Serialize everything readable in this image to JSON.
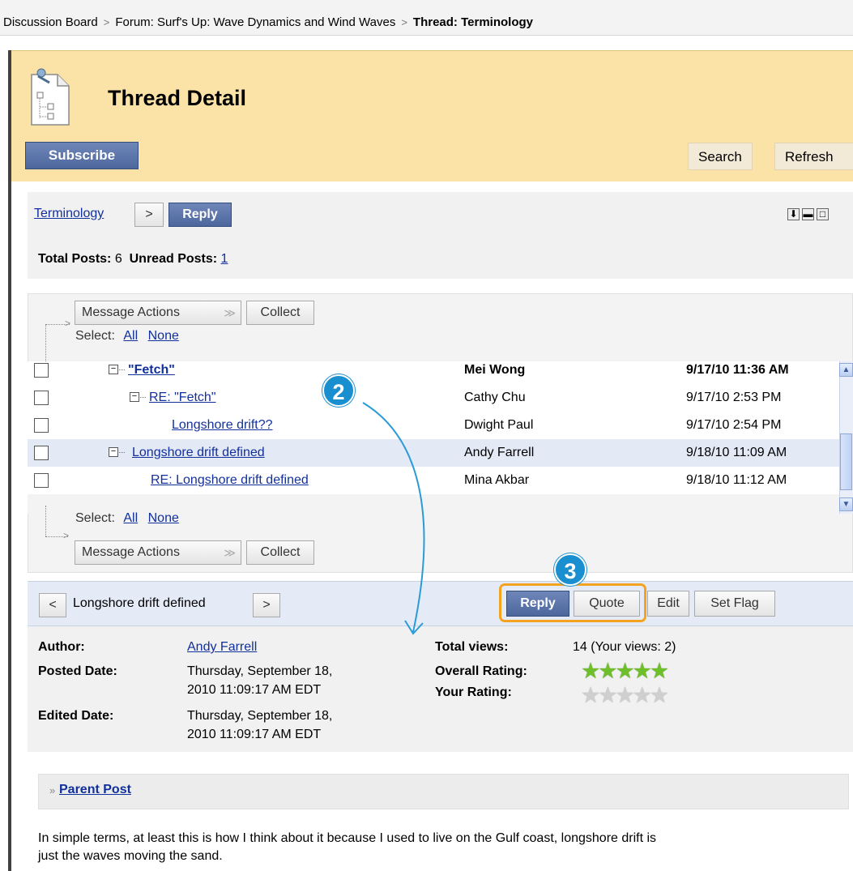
{
  "breadcrumb": {
    "items": [
      "Discussion Board",
      "Forum: Surf's Up: Wave Dynamics and Wind Waves"
    ],
    "current": "Thread: Terminology"
  },
  "header": {
    "title": "Thread Detail",
    "subscribe": "Subscribe",
    "search": "Search",
    "refresh": "Refresh"
  },
  "thread_bar": {
    "thread_link": "Terminology",
    "next_glyph": ">",
    "reply": "Reply",
    "total_label": "Total Posts:",
    "total_value": "6",
    "unread_label": "Unread Posts:",
    "unread_value": "1"
  },
  "list_controls": {
    "message_actions": "Message Actions",
    "collect": "Collect",
    "select_label": "Select:",
    "all": "All",
    "none": "None"
  },
  "messages": [
    {
      "subject": "\"Fetch\"",
      "author": "Mei Wong",
      "date": "9/17/10 11:36 AM"
    },
    {
      "subject": "RE: \"Fetch\"",
      "author": "Cathy Chu",
      "date": "9/17/10 2:53 PM"
    },
    {
      "subject": "Longshore drift??",
      "author": "Dwight Paul",
      "date": "9/17/10 2:54 PM"
    },
    {
      "subject": "Longshore drift defined",
      "author": "Andy Farrell",
      "date": "9/18/10 11:09 AM"
    },
    {
      "subject": "RE: Longshore drift defined",
      "author": "Mina Akbar",
      "date": "9/18/10 11:12 AM"
    }
  ],
  "detail": {
    "prev_glyph": "<",
    "next_glyph": ">",
    "subject": "Longshore drift defined",
    "reply": "Reply",
    "quote": "Quote",
    "edit": "Edit",
    "set_flag": "Set Flag",
    "author_label": "Author:",
    "author": "Andy Farrell",
    "posted_label": "Posted Date:",
    "posted_line1": "Thursday, September 18,",
    "posted_line2": "2010 11:09:17 AM EDT",
    "edited_label": "Edited Date:",
    "edited_line1": "Thursday, September 18,",
    "edited_line2": "2010 11:09:17 AM EDT",
    "views_label": "Total views:",
    "views": "14 (Your views: 2)",
    "overall_label": "Overall Rating:",
    "overall_rating": 5,
    "your_label": "Your Rating:",
    "your_rating": 0
  },
  "parent_post": {
    "glyph": "»",
    "label": "Parent Post"
  },
  "body_text": {
    "line1": "In simple terms, at least this is how I think about it because I used to live on the Gulf coast, longshore drift is",
    "line2": "just the waves moving the sand."
  },
  "callouts": {
    "step2": "2",
    "step3": "3"
  },
  "colors": {
    "header_bg": "#fbe2a6",
    "blue_button": "#5a73a8",
    "callout": "#1a8fcf",
    "highlight": "#f5a31f",
    "star_filled": "#6fbf2a",
    "star_empty": "#cfcfcf",
    "link": "#12309c"
  }
}
